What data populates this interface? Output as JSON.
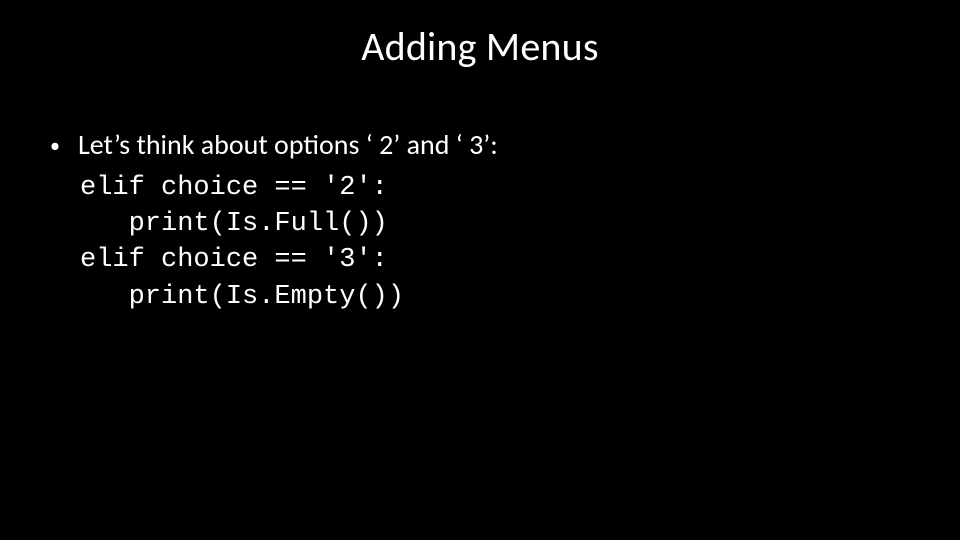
{
  "title": "Adding Menus",
  "bullet": {
    "dot": "•",
    "text": "Let’s think about options ‘ 2’ and ‘ 3’:"
  },
  "code": {
    "l1": "elif choice == '2':",
    "l2": "   print(Is.Full())",
    "l3": "elif choice == '3':",
    "l4": "   print(Is.Empty())"
  }
}
